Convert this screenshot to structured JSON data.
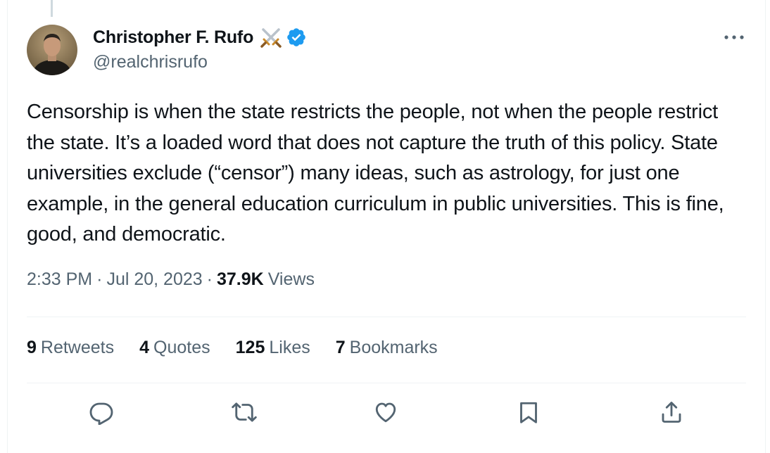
{
  "author": {
    "display_name": "Christopher F. Rufo",
    "handle": "@realchrisrufo",
    "name_emoji_icon": "crossed-swords-icon",
    "verified_icon": "verified-badge-icon"
  },
  "tweet": {
    "text": "Censorship is when the state restricts the people, not when the people restrict the state. It’s a loaded word that does not capture the truth of this policy. State universities exclude (“censor”) many ideas, such as astrology, for just one example, in the general education curriculum in public universities. This is fine, good, and democratic.",
    "time": "2:33 PM",
    "separator": "·",
    "date": "Jul 20, 2023",
    "views_count": "37.9K",
    "views_label": "Views"
  },
  "stats": [
    {
      "count": "9",
      "label": "Retweets"
    },
    {
      "count": "4",
      "label": "Quotes"
    },
    {
      "count": "125",
      "label": "Likes"
    },
    {
      "count": "7",
      "label": "Bookmarks"
    }
  ],
  "actions": [
    "reply-icon",
    "retweet-icon",
    "like-icon",
    "bookmark-icon",
    "share-icon"
  ],
  "colors": {
    "verified": "#1d9bf0",
    "secondary_text": "#536471",
    "primary_text": "#0f1419",
    "divider": "#eff3f4"
  }
}
